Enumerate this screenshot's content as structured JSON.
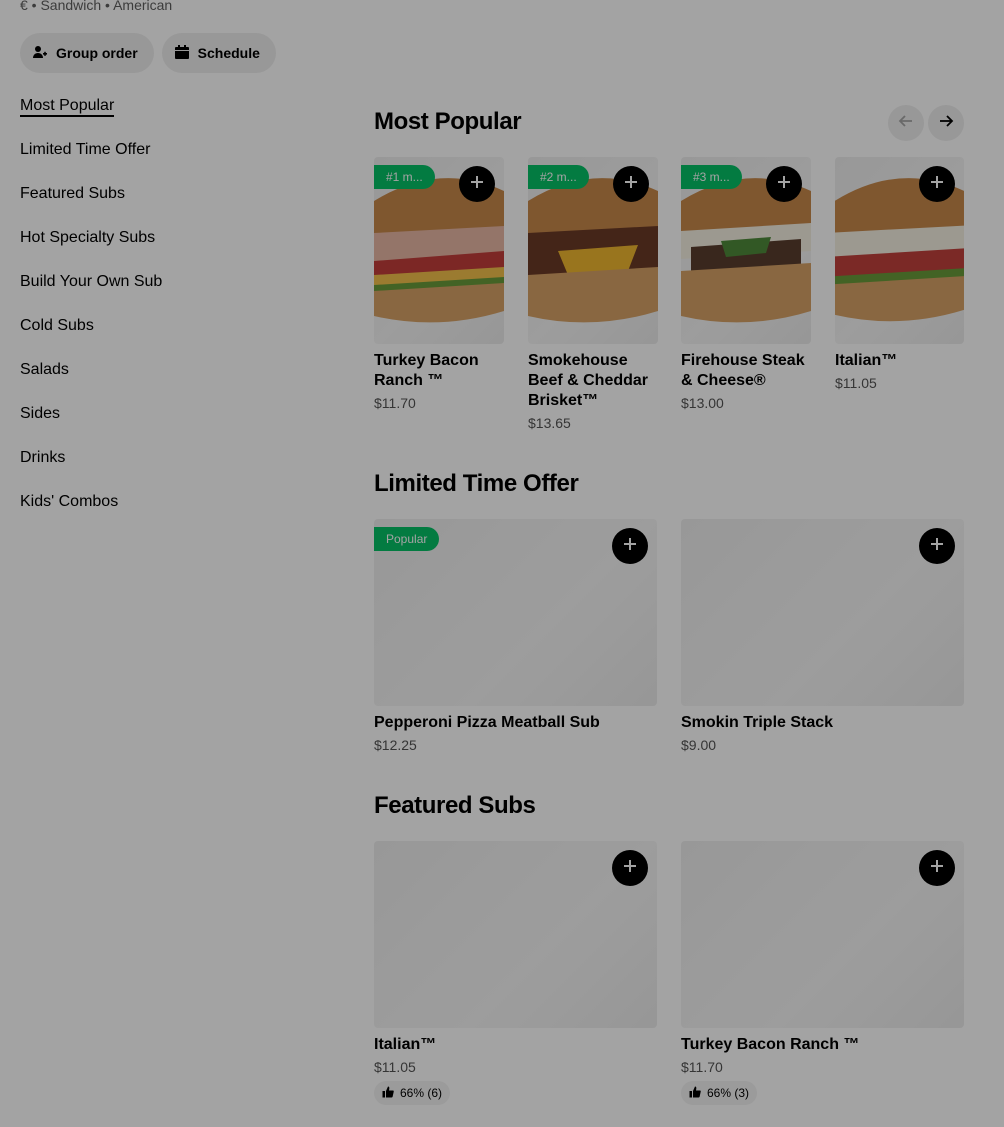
{
  "store": {
    "meta_line": "€ • Sandwich • American"
  },
  "actions": {
    "group_order": "Group order",
    "schedule": "Schedule"
  },
  "sidebar": {
    "items": [
      {
        "label": "Most Popular",
        "active": true
      },
      {
        "label": "Limited Time Offer"
      },
      {
        "label": "Featured Subs"
      },
      {
        "label": "Hot Specialty Subs"
      },
      {
        "label": "Build Your Own Sub"
      },
      {
        "label": "Cold Subs"
      },
      {
        "label": "Salads"
      },
      {
        "label": "Sides"
      },
      {
        "label": "Drinks"
      },
      {
        "label": "Kids' Combos"
      }
    ]
  },
  "sections": {
    "most_popular": {
      "title": "Most Popular",
      "items": [
        {
          "badge": "#1 m...",
          "name_line1": "Turkey Bacon",
          "name_line2": "Ranch ™",
          "name_line3": "",
          "price": "$11.70"
        },
        {
          "badge": "#2 m...",
          "name_line1": "Smokehouse",
          "name_line2": "Beef & Cheddar",
          "name_line3": "Brisket™",
          "price": "$13.65"
        },
        {
          "badge": "#3 m...",
          "name_line1": "Firehouse Steak",
          "name_line2": "& Cheese®",
          "name_line3": "",
          "price": "$13.00"
        },
        {
          "badge": "",
          "name_line1": "Italian™",
          "name_line2": "",
          "name_line3": "",
          "price": "$11.05"
        }
      ]
    },
    "limited_time_offer": {
      "title": "Limited Time Offer",
      "items": [
        {
          "badge": "Popular",
          "name": "Pepperoni Pizza Meatball Sub",
          "price": "$12.25"
        },
        {
          "badge": "",
          "name": "Smokin Triple Stack",
          "price": "$9.00"
        }
      ]
    },
    "featured_subs": {
      "title": "Featured Subs",
      "items": [
        {
          "name": "Italian™",
          "price": "$11.05",
          "rating": "66% (6)"
        },
        {
          "name": "Turkey Bacon Ranch ™",
          "price": "$11.70",
          "rating": "66% (3)"
        }
      ]
    }
  },
  "icons": {
    "group_order": "person-plus-icon",
    "schedule": "calendar-icon",
    "add": "plus-icon",
    "prev": "arrow-left-icon",
    "next": "arrow-right-icon",
    "rating": "thumbs-up-icon"
  },
  "colors": {
    "badge_green": "#06c167",
    "overlay": "rgba(0,0,0,0.36)"
  }
}
